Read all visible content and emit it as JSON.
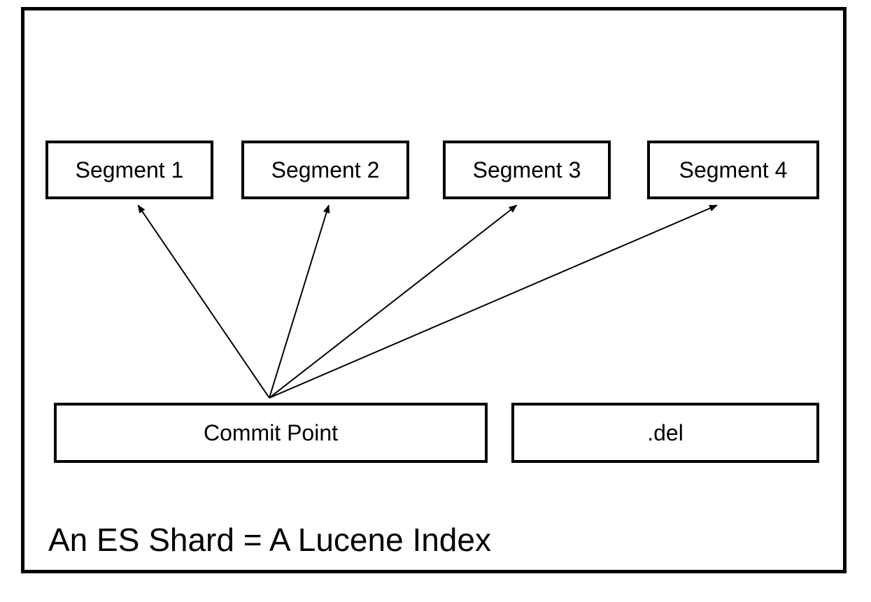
{
  "segments": {
    "s1": "Segment 1",
    "s2": "Segment 2",
    "s3": "Segment 3",
    "s4": "Segment 4"
  },
  "commit_point": "Commit Point",
  "del_file": ".del",
  "caption": "An ES Shard = A Lucene Index"
}
